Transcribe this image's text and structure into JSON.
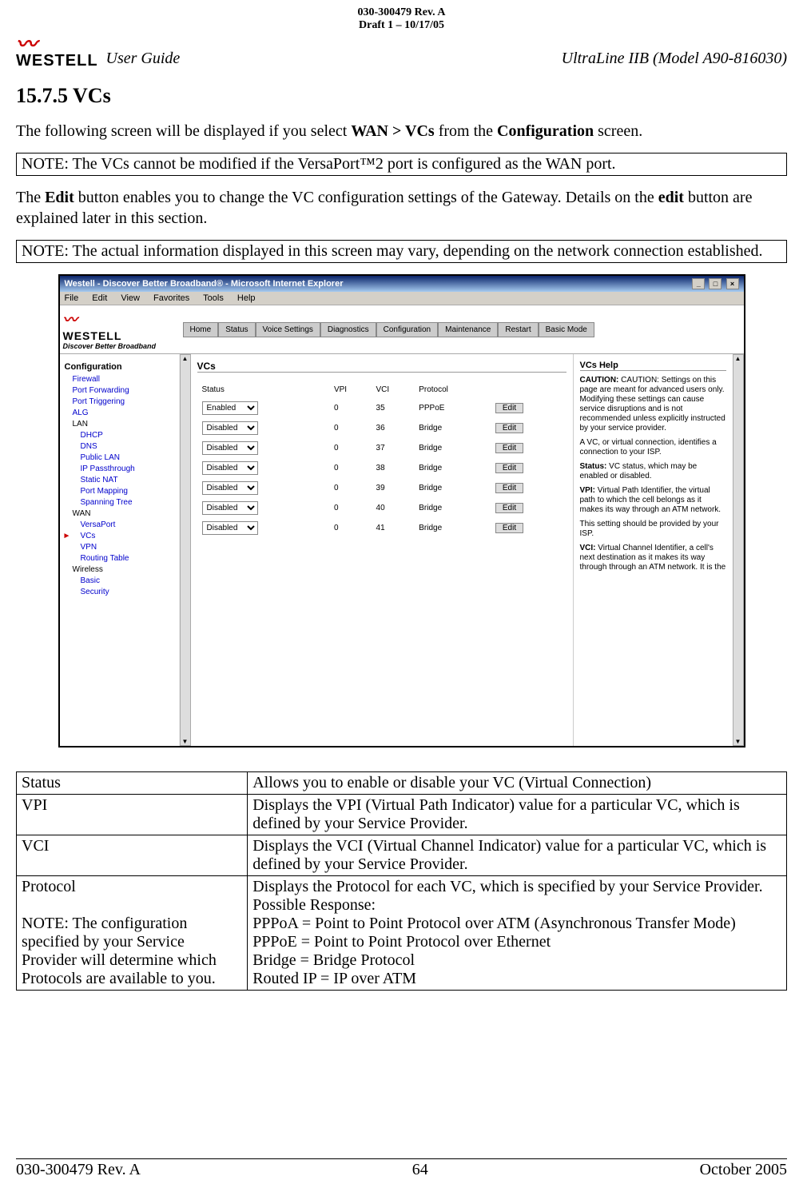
{
  "doc_header": {
    "line1": "030-300479 Rev. A",
    "line2": "Draft 1 – 10/17/05"
  },
  "logo_text": "WESTELL",
  "user_guide": "User Guide",
  "model": "UltraLine IIB (Model A90-816030)",
  "section": "15.7.5 VCs",
  "intro": "The following screen will be displayed if you select WAN > VCs from the Configuration screen.",
  "note1": "NOTE: The VCs cannot be modified if the VersaPort™2 port is configured as the WAN port.",
  "edit_para": "The Edit button enables you to change the VC configuration settings of the Gateway. Details on the edit button are explained later in this section.",
  "note2": "NOTE: The actual information displayed in this screen may vary, depending on the network connection established.",
  "ie": {
    "title": "Westell - Discover Better Broadband® - Microsoft Internet Explorer",
    "menu": [
      "File",
      "Edit",
      "View",
      "Favorites",
      "Tools",
      "Help"
    ],
    "tagline": "Discover Better Broadband",
    "tabs": [
      "Home",
      "Status",
      "Voice Settings",
      "Diagnostics",
      "Configuration",
      "Maintenance",
      "Restart",
      "Basic Mode"
    ],
    "sidebar": {
      "config": "Configuration",
      "items": [
        "Firewall",
        "Port Forwarding",
        "Port Triggering",
        "ALG"
      ],
      "lan": "LAN",
      "lan_items": [
        "DHCP",
        "DNS",
        "Public LAN",
        "IP Passthrough",
        "Static NAT",
        "Port Mapping",
        "Spanning Tree"
      ],
      "wan": "WAN",
      "wan_items": [
        "VersaPort",
        "VCs",
        "VPN",
        "Routing Table"
      ],
      "wireless": "Wireless",
      "wireless_items": [
        "Basic",
        "Security"
      ]
    },
    "vc": {
      "title": "VCs",
      "cols": [
        "Status",
        "VPI",
        "VCI",
        "Protocol"
      ],
      "rows": [
        {
          "status": "Enabled",
          "vpi": "0",
          "vci": "35",
          "proto": "PPPoE"
        },
        {
          "status": "Disabled",
          "vpi": "0",
          "vci": "36",
          "proto": "Bridge"
        },
        {
          "status": "Disabled",
          "vpi": "0",
          "vci": "37",
          "proto": "Bridge"
        },
        {
          "status": "Disabled",
          "vpi": "0",
          "vci": "38",
          "proto": "Bridge"
        },
        {
          "status": "Disabled",
          "vpi": "0",
          "vci": "39",
          "proto": "Bridge"
        },
        {
          "status": "Disabled",
          "vpi": "0",
          "vci": "40",
          "proto": "Bridge"
        },
        {
          "status": "Disabled",
          "vpi": "0",
          "vci": "41",
          "proto": "Bridge"
        }
      ],
      "edit_label": "Edit"
    },
    "help": {
      "title": "VCs Help",
      "p1": "CAUTION: Settings on this page are meant for advanced users only. Modifying these settings can cause service disruptions and is not recommended unless explicitly instructed by your service provider.",
      "p2": "A VC, or virtual connection, identifies a connection to your ISP.",
      "p3": "Status: VC status, which may be enabled or disabled.",
      "p4": "VPI: Virtual Path Identifier, the virtual path to which the cell belongs as it makes its way through an ATM network.",
      "p5": "This setting should be provided by your ISP.",
      "p6": "VCI: Virtual Channel Identifier, a cell's next destination as it makes its way through through an ATM network. It is the"
    }
  },
  "def_table": [
    {
      "k": "Status",
      "v": "Allows you to enable or disable your VC (Virtual Connection)"
    },
    {
      "k": "VPI",
      "v": "Displays the VPI (Virtual Path Indicator) value for a particular VC, which is defined by your Service Provider."
    },
    {
      "k": "VCI",
      "v": "Displays the VCI (Virtual Channel Indicator) value for a particular VC, which is defined by your Service Provider."
    },
    {
      "k": "Protocol\n\nNOTE: The configuration specified by your Service Provider will determine which Protocols are available to you.",
      "v": "Displays the Protocol for each VC, which is specified by your Service Provider.\nPossible Response:\nPPPoA = Point to Point Protocol over ATM (Asynchronous Transfer Mode)\nPPPoE = Point to Point Protocol over Ethernet\nBridge = Bridge Protocol\nRouted IP = IP over ATM"
    }
  ],
  "footer": {
    "left": "030-300479 Rev. A",
    "center": "64",
    "right": "October 2005"
  }
}
